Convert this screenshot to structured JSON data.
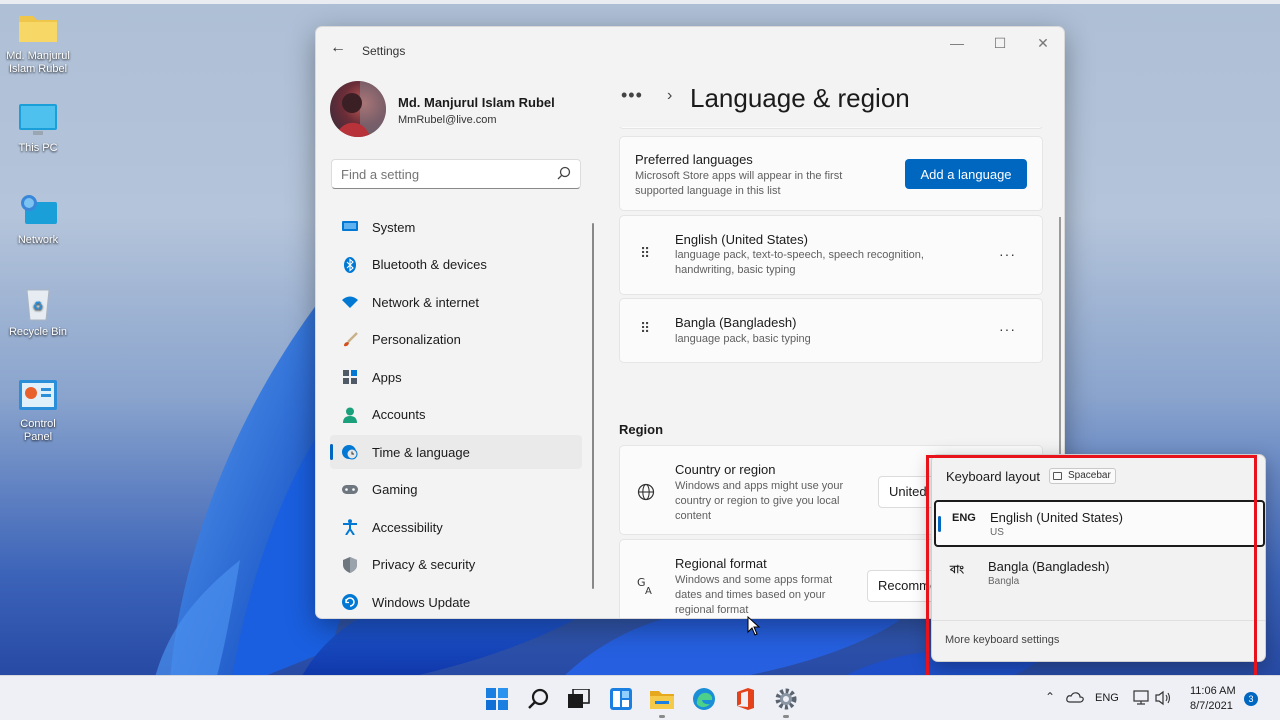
{
  "desktop": {
    "icons": [
      {
        "label": "Md. Manjurul Islam Rubel",
        "icon": "folder-icon"
      },
      {
        "label": "This PC",
        "icon": "monitor-icon"
      },
      {
        "label": "Network",
        "icon": "network-icon"
      },
      {
        "label": "Recycle Bin",
        "icon": "recycle-bin-icon"
      },
      {
        "label": "Control Panel",
        "icon": "control-panel-icon"
      }
    ]
  },
  "settings": {
    "window_title": "Settings",
    "profile": {
      "name": "Md. Manjurul Islam Rubel",
      "email": "MmRubel@live.com"
    },
    "search": {
      "placeholder": "Find a setting"
    },
    "nav": [
      {
        "label": "System",
        "icon": "system-icon",
        "color": "#0078d4"
      },
      {
        "label": "Bluetooth & devices",
        "icon": "bluetooth-icon",
        "color": "#0078d4"
      },
      {
        "label": "Network & internet",
        "icon": "wifi-icon",
        "color": "#0078d4"
      },
      {
        "label": "Personalization",
        "icon": "brush-icon",
        "color": "#c25e1f"
      },
      {
        "label": "Apps",
        "icon": "apps-icon",
        "color": "#505a66"
      },
      {
        "label": "Accounts",
        "icon": "person-icon",
        "color": "#1aa07a"
      },
      {
        "label": "Time & language",
        "icon": "globe-clock-icon",
        "color": "#0078d4",
        "active": true
      },
      {
        "label": "Gaming",
        "icon": "gamepad-icon",
        "color": "#6e7680"
      },
      {
        "label": "Accessibility",
        "icon": "accessibility-icon",
        "color": "#0078d4"
      },
      {
        "label": "Privacy & security",
        "icon": "shield-icon",
        "color": "#6e7680"
      },
      {
        "label": "Windows Update",
        "icon": "update-icon",
        "color": "#0078d4"
      }
    ],
    "breadcrumb": {
      "ellipsis": "•••",
      "chevron": "›",
      "title": "Language & region"
    },
    "preferred": {
      "title": "Preferred languages",
      "description": "Microsoft Store apps will appear in the first supported language in this list",
      "button": "Add a language"
    },
    "languages": [
      {
        "name": "English (United States)",
        "features": "language pack, text-to-speech, speech recognition, handwriting, basic typing",
        "more": "···"
      },
      {
        "name": "Bangla (Bangladesh)",
        "features": "language pack, basic typing",
        "more": "···"
      }
    ],
    "region": {
      "heading": "Region",
      "country": {
        "title": "Country or region",
        "description": "Windows and apps might use your country or region to give you local content",
        "value": "United States"
      },
      "format": {
        "title": "Regional format",
        "description": "Windows and some apps format dates and times based on your regional format",
        "value": "Recommended"
      }
    }
  },
  "keyboard_flyout": {
    "title": "Keyboard layout",
    "shortcut": "Spacebar",
    "layouts": [
      {
        "code": "ENG",
        "name": "English (United States)",
        "sub": "US",
        "selected": true
      },
      {
        "code": "বাং",
        "name": "Bangla (Bangladesh)",
        "sub": "Bangla",
        "selected": false
      }
    ],
    "more": "More keyboard settings"
  },
  "taskbar": {
    "apps": [
      "start-icon",
      "search-icon",
      "task-view-icon",
      "widgets-icon",
      "file-explorer-icon",
      "edge-icon",
      "office-icon",
      "settings-icon"
    ],
    "tray": {
      "language": "ENG",
      "time": "11:06 AM",
      "date": "8/7/2021",
      "notifications": "3"
    }
  },
  "colors": {
    "accent": "#0067c0",
    "highlight": "#e8121c"
  }
}
